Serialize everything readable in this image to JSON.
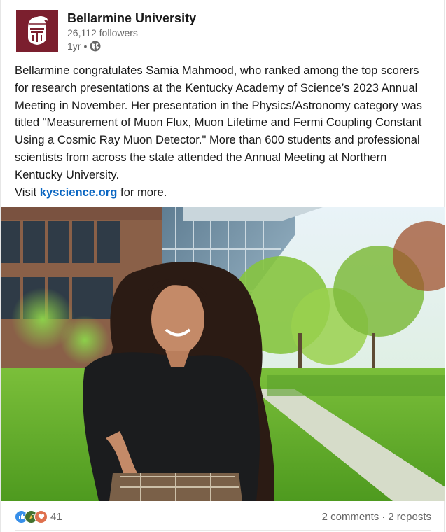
{
  "header": {
    "org_name": "Bellarmine University",
    "followers": "26,112 followers",
    "age": "1yr",
    "separator": "•",
    "logo_icon": "knight-helmet-icon",
    "visibility_icon": "globe-icon",
    "logo_color": "#7b1f2e"
  },
  "post": {
    "text": "Bellarmine congratulates Samia Mahmood, who ranked among the top scorers for research presentations at the Kentucky Academy of Science’s 2023 Annual Meeting in November. Her presentation in the Physics/Astronomy category was titled \"Measurement of Muon Flux, Muon Lifetime and Fermi Coupling Constant Using a Cosmic Ray Muon Detector.\" More than 600 students and professional scientists from across the state attended the Annual Meeting at Northern Kentucky University.",
    "visit_prefix": "Visit",
    "link_text": "kyscience.org",
    "visit_suffix": "for more.",
    "link_color": "#0a66c2"
  },
  "social": {
    "reaction_icons": [
      "like-icon",
      "celebrate-icon",
      "love-icon"
    ],
    "reaction_count": "41",
    "comments": "2 comments",
    "dot": "·",
    "reposts": "2 reposts"
  }
}
